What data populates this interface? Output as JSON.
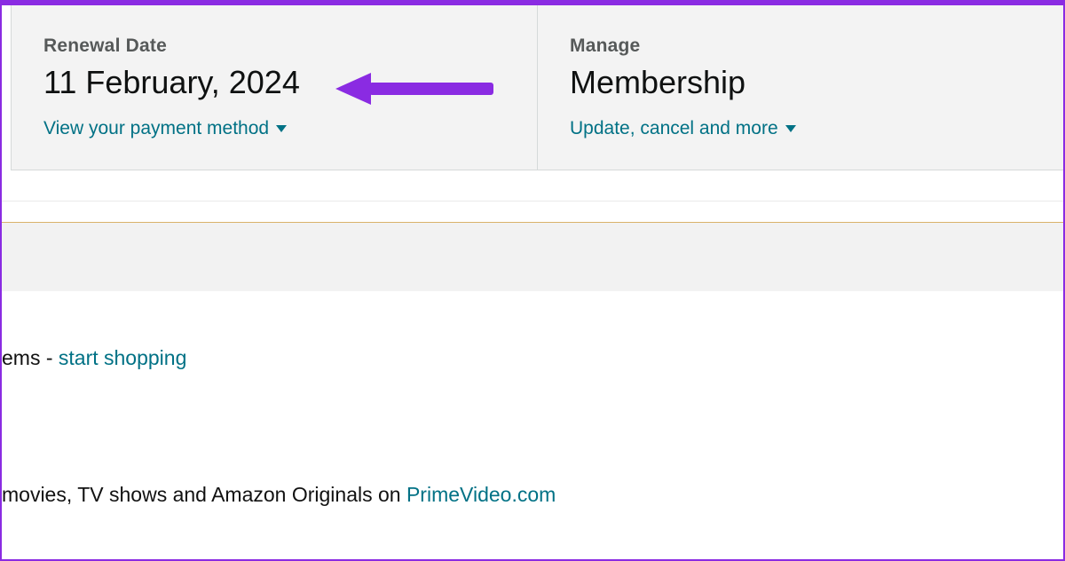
{
  "cards": {
    "renewal": {
      "label": "Renewal Date",
      "value": "11 February, 2024",
      "link": "View your payment method"
    },
    "manage": {
      "label": "Manage",
      "value": "Membership",
      "link": "Update, cancel and more"
    }
  },
  "content": {
    "ems_prefix": "ems - ",
    "start_shopping": "start shopping",
    "pv_prefix": "movies, TV shows and Amazon Originals on ",
    "pv_link": "PrimeVideo.com"
  }
}
